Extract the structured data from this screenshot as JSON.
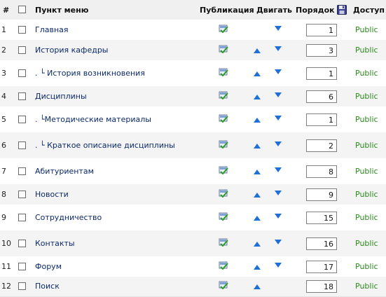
{
  "columns": {
    "num": "#",
    "title": "Пункт меню",
    "publication": "Публикация",
    "move": "Двигать",
    "order": "Порядок",
    "access": "Доступ"
  },
  "rows": [
    {
      "num": "1",
      "title": "Главная",
      "order": "1",
      "access": "Public",
      "up": false,
      "down": true
    },
    {
      "num": "2",
      "title": "История кафедры",
      "order": "3",
      "access": "Public",
      "up": true,
      "down": true
    },
    {
      "num": "3",
      "title": ".      └ История возникновения",
      "order": "1",
      "access": "Public",
      "up": true,
      "down": true
    },
    {
      "num": "4",
      "title": "Дисциплины",
      "order": "6",
      "access": "Public",
      "up": true,
      "down": true
    },
    {
      "num": "5",
      "title": ".      └Методические материалы",
      "order": "1",
      "access": "Public",
      "up": true,
      "down": true
    },
    {
      "num": "6",
      "title": ".      └ Краткое описание дисциплины",
      "order": "2",
      "access": "Public",
      "up": true,
      "down": true
    },
    {
      "num": "7",
      "title": "Абитуриентам",
      "order": "8",
      "access": "Public",
      "up": true,
      "down": true
    },
    {
      "num": "8",
      "title": "Новости",
      "order": "9",
      "access": "Public",
      "up": true,
      "down": true
    },
    {
      "num": "9",
      "title": "Сотрудничество",
      "order": "15",
      "access": "Public",
      "up": true,
      "down": true
    },
    {
      "num": "10",
      "title": "Контакты",
      "order": "16",
      "access": "Public",
      "up": true,
      "down": true
    },
    {
      "num": "11",
      "title": "Форум",
      "order": "17",
      "access": "Public",
      "up": true,
      "down": true
    },
    {
      "num": "12",
      "title": "Поиск",
      "order": "18",
      "access": "Public",
      "up": true,
      "down": false
    }
  ],
  "icons": {
    "save": "save-order-icon",
    "published": "published-icon",
    "up": "move-up-icon",
    "down": "move-down-icon"
  },
  "colors": {
    "link": "#0b2a6a",
    "access": "#2a8a19",
    "arrow": "#1e6fd6"
  }
}
